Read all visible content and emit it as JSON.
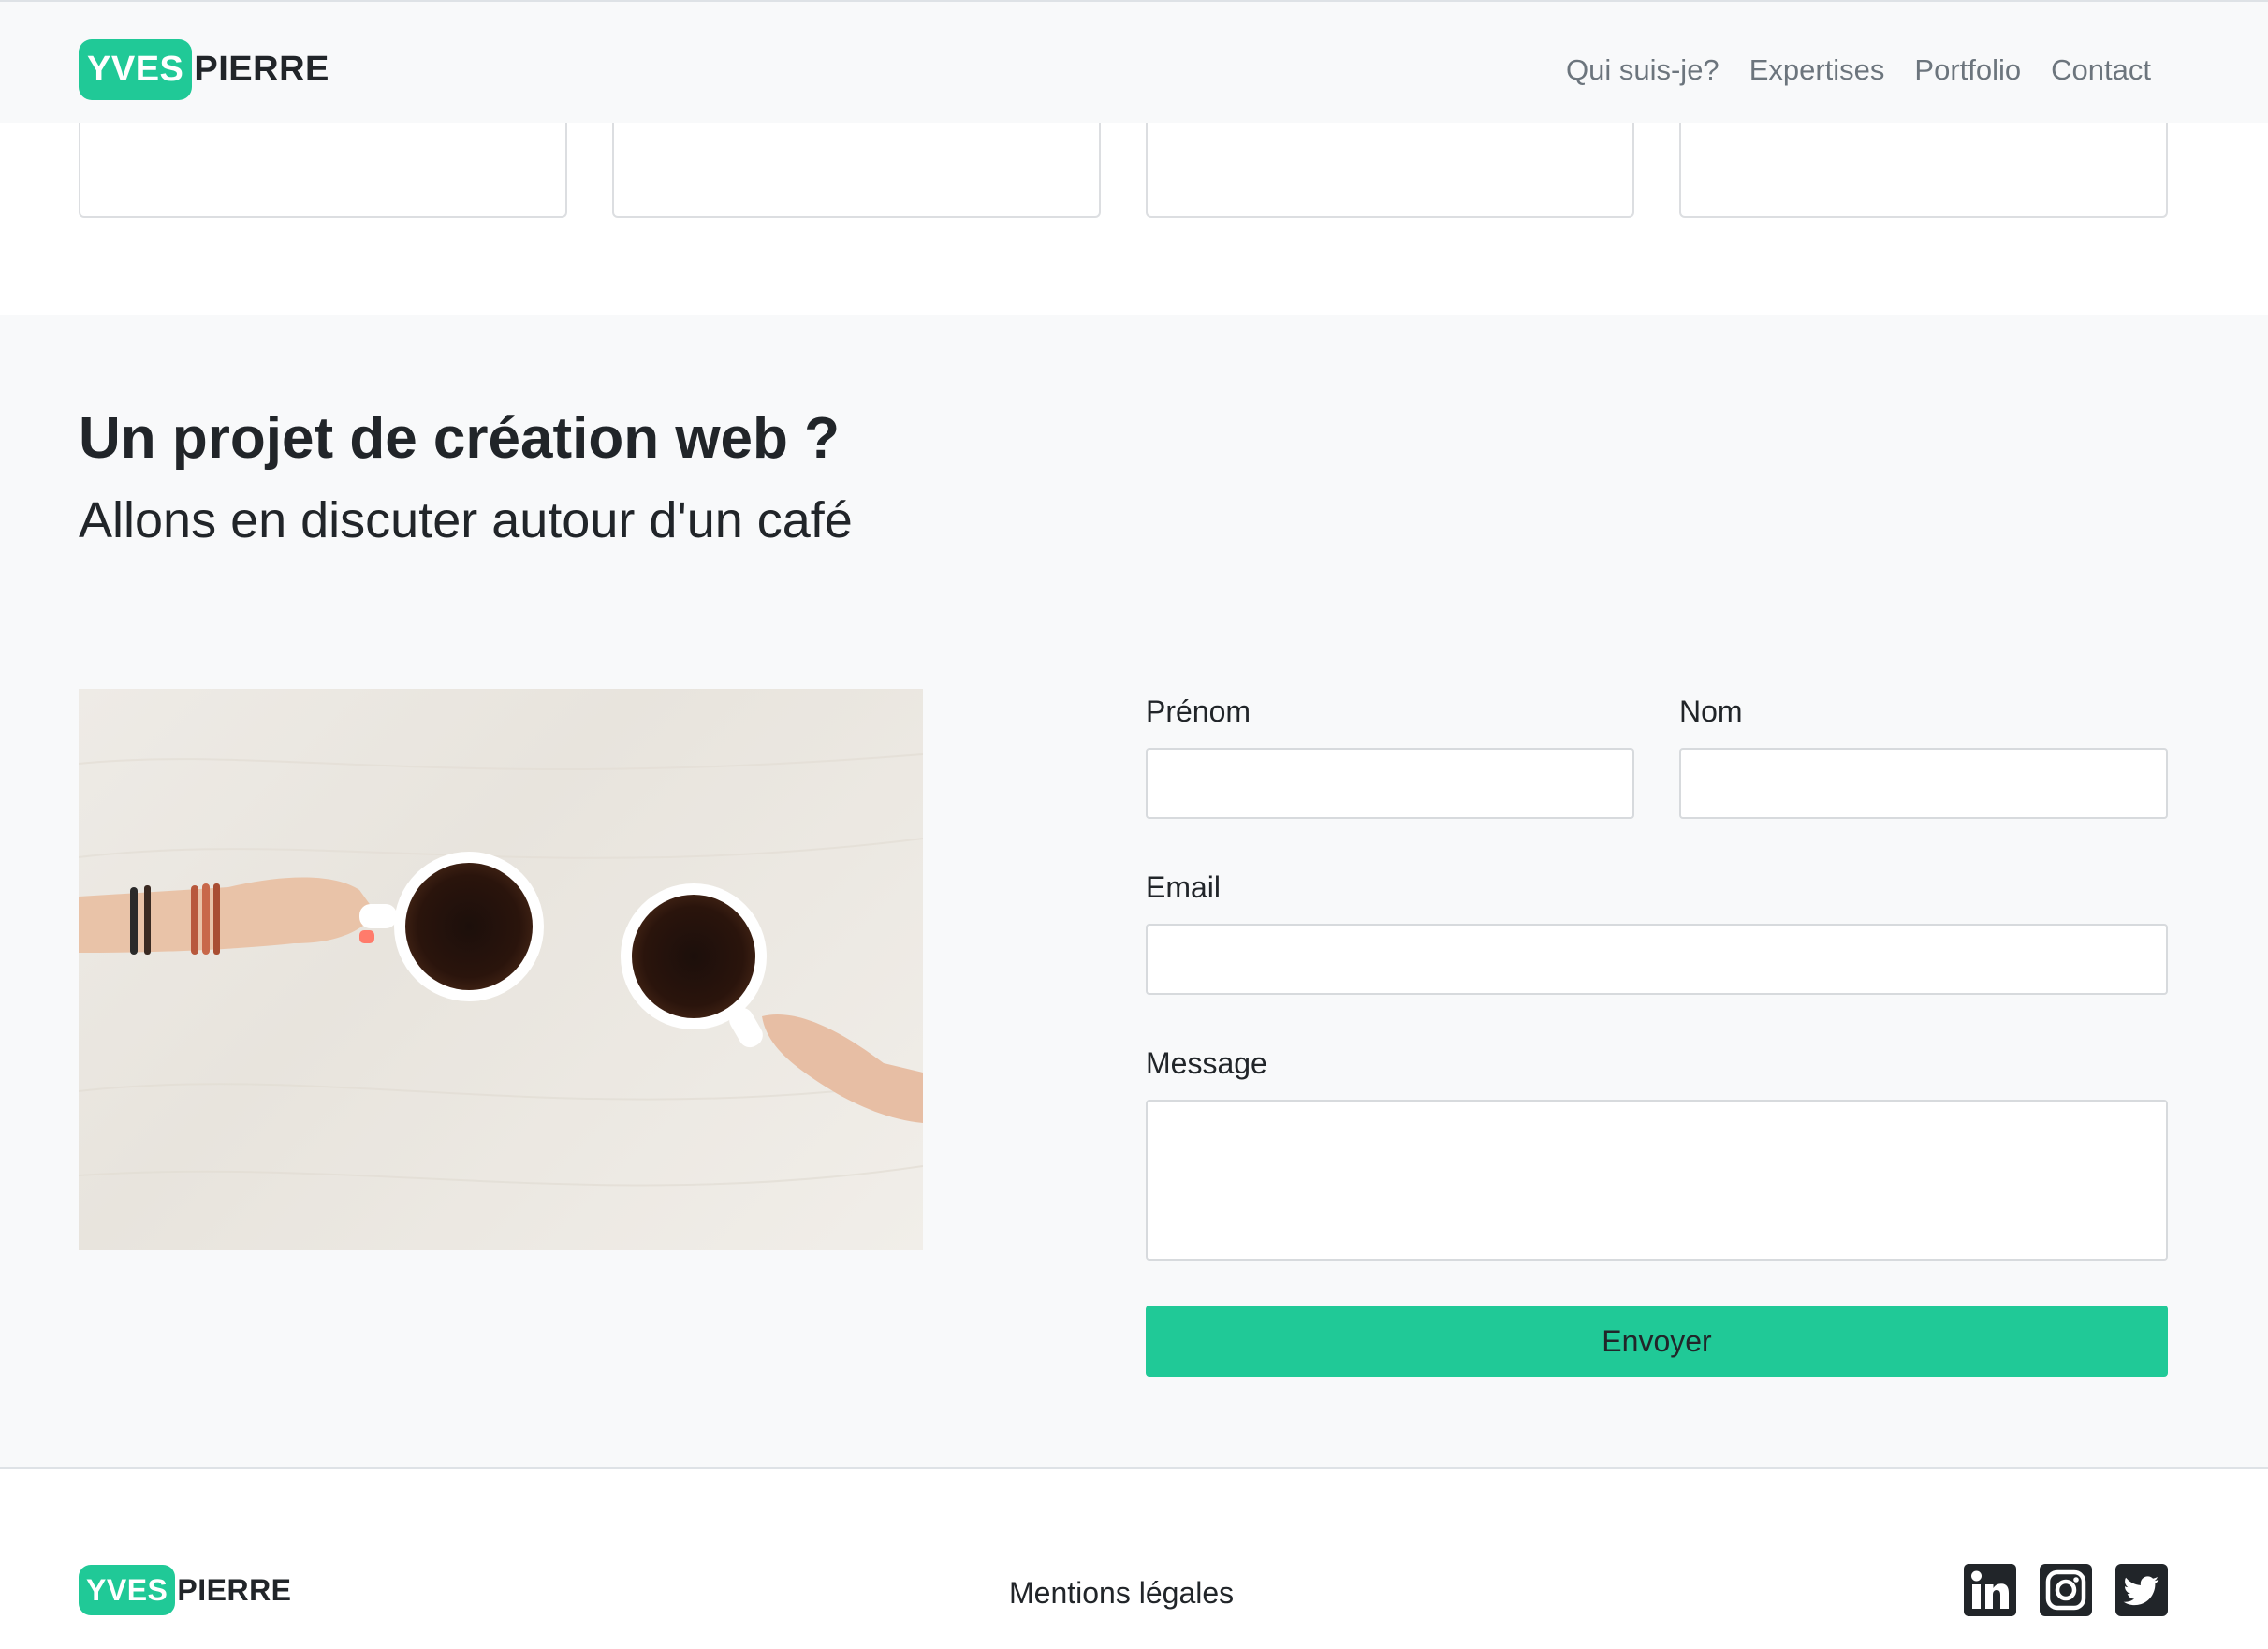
{
  "brand": {
    "highlight": "YVES",
    "rest": "PIERRE"
  },
  "nav": {
    "items": [
      {
        "label": "Qui suis-je?"
      },
      {
        "label": "Expertises"
      },
      {
        "label": "Portfolio"
      },
      {
        "label": "Contact"
      }
    ]
  },
  "contact": {
    "title": "Un projet de création web ?",
    "subtitle": "Allons en discuter autour d'un café",
    "form": {
      "firstname_label": "Prénom",
      "firstname_value": "",
      "lastname_label": "Nom",
      "lastname_value": "",
      "email_label": "Email",
      "email_value": "",
      "message_label": "Message",
      "message_value": "",
      "submit_label": "Envoyer"
    }
  },
  "footer": {
    "brand": {
      "highlight": "YVES",
      "rest": "PIERRE"
    },
    "legal_label": "Mentions légales",
    "social": [
      "linkedin-icon",
      "instagram-icon",
      "twitter-icon"
    ]
  },
  "colors": {
    "accent": "#20c997",
    "background": "#f8f9fa",
    "text": "#212529",
    "muted": "#6c757d"
  }
}
